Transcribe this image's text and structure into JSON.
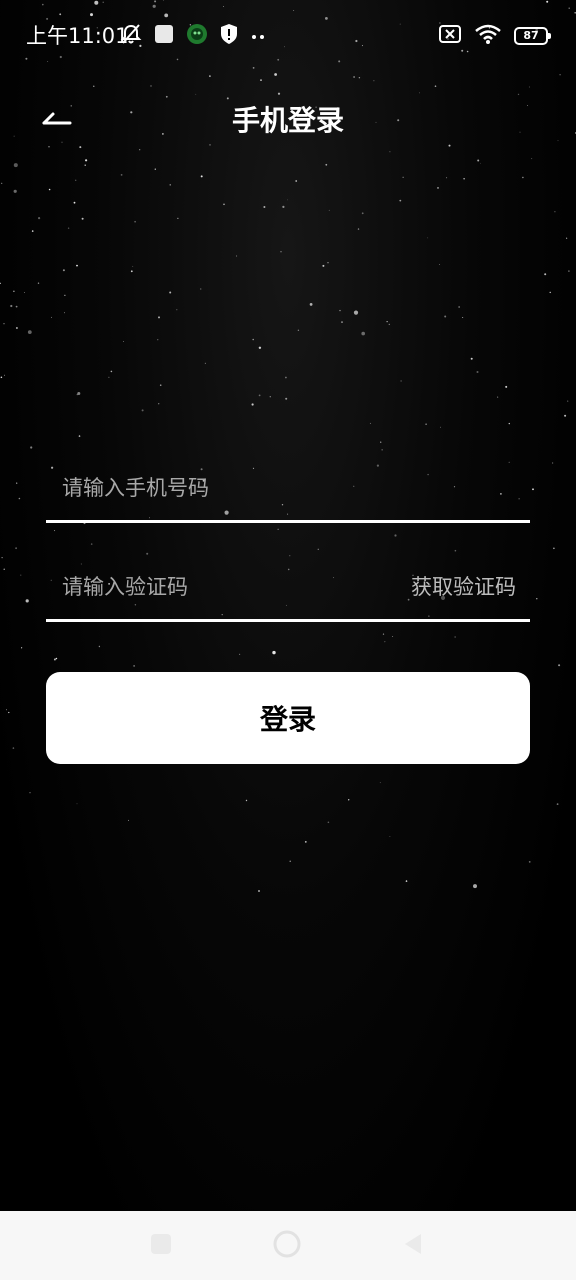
{
  "status_bar": {
    "time": "上午11:01",
    "battery_level": "87",
    "left_icons": [
      "notifications-off-icon",
      "app-square-icon",
      "app-round-icon",
      "shield-icon",
      "more-dots-icon"
    ],
    "right_icons": [
      "sim-off-icon",
      "wifi-icon",
      "battery-icon"
    ]
  },
  "header": {
    "title": "手机登录",
    "back_icon": "back-arrow-icon"
  },
  "form": {
    "phone_placeholder": "请输入手机号码",
    "phone_value": "",
    "code_placeholder": "请输入验证码",
    "code_value": "",
    "get_code_label": "获取验证码"
  },
  "login_button": {
    "label": "登录"
  },
  "nav_bar": {
    "buttons": [
      "recents-square-icon",
      "home-circle-icon",
      "back-triangle-icon"
    ]
  },
  "colors": {
    "background": "#000000",
    "text": "#ffffff",
    "placeholder": "#a8a8a8",
    "button_bg": "#ffffff",
    "button_text": "#000000",
    "nav_bar_bg": "#f7f7f7"
  }
}
